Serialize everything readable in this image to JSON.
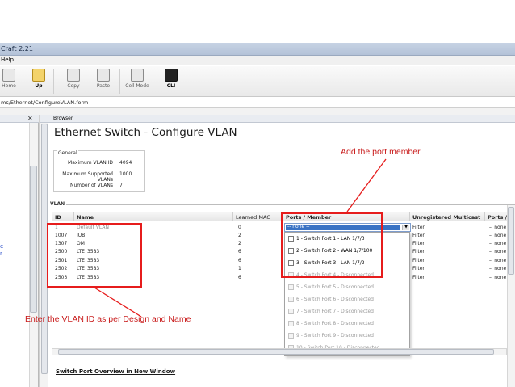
{
  "window": {
    "title": "Craft 2.21"
  },
  "menu": {
    "help": "Help"
  },
  "toolbar": {
    "home": "Home",
    "up": "Up",
    "copy": "Copy",
    "paste": "Paste",
    "cell_mode": "Cell Mode",
    "cli": "CLI"
  },
  "address": {
    "path": "ms/Ethernet/ConfigureVLAN.form"
  },
  "panes": {
    "close": "✕",
    "browser": "Browser",
    "left_links": [
      "e",
      "r"
    ]
  },
  "page": {
    "title": "Ethernet Switch - Configure VLAN"
  },
  "general": {
    "legend": "General",
    "rows": [
      {
        "label": "Maximum VLAN ID",
        "value": "4094"
      },
      {
        "label": "Maximum Supported VLANs",
        "value": "1000"
      },
      {
        "label": "Number of VLANs",
        "value": "7"
      }
    ]
  },
  "vlan": {
    "legend": "VLAN",
    "headers": {
      "id": "ID",
      "name": "Name",
      "learned": "Learned MAC",
      "ports": "Ports / Member",
      "unreg": "Unregistered Multicast",
      "ports2": "Ports / U"
    },
    "rows": [
      {
        "id": "1",
        "name": "Default VLAN",
        "learned": "0",
        "unreg": "Filter",
        "ports2": "-- none --"
      },
      {
        "id": "1007",
        "name": "IUB",
        "learned": "2",
        "unreg": "Filter",
        "ports2": "-- none --"
      },
      {
        "id": "1307",
        "name": "OM",
        "learned": "2",
        "unreg": "Filter",
        "ports2": "-- none --"
      },
      {
        "id": "2500",
        "name": "LTE_3583",
        "learned": "6",
        "unreg": "Filter",
        "ports2": "-- none --"
      },
      {
        "id": "2501",
        "name": "LTE_3583",
        "learned": "6",
        "unreg": "Filter",
        "ports2": "-- none --"
      },
      {
        "id": "2502",
        "name": "LTE_3583",
        "learned": "1",
        "unreg": "Filter",
        "ports2": "-- none --"
      },
      {
        "id": "2503",
        "name": "LTE_3583",
        "learned": "6",
        "unreg": "Filter",
        "ports2": "-- none --"
      }
    ],
    "port_select": {
      "value": "-- none --"
    },
    "port_options": [
      {
        "label": "1 - Switch Port 1 - LAN 1/7/3",
        "enabled": true
      },
      {
        "label": "2 - Switch Port 2 - WAN 1/7/100",
        "enabled": true
      },
      {
        "label": "3 - Switch Port 3 - LAN 1/7/2",
        "enabled": true
      },
      {
        "label": "4 - Switch Port 4 - Disconnected",
        "enabled": false
      },
      {
        "label": "5 - Switch Port 5 - Disconnected",
        "enabled": false
      },
      {
        "label": "6 - Switch Port 6 - Disconnected",
        "enabled": false
      },
      {
        "label": "7 - Switch Port 7 - Disconnected",
        "enabled": false
      },
      {
        "label": "8 - Switch Port 8 - Disconnected",
        "enabled": false
      },
      {
        "label": "9 - Switch Port 9 - Disconnected",
        "enabled": false
      },
      {
        "label": "10 - Switch Port 10 - Disconnected",
        "enabled": false
      }
    ]
  },
  "links": {
    "overview": "Switch Port Overview in New Window"
  },
  "annotations": {
    "port_member": "Add the port member",
    "vlan_id": "Enter the VLAN ID as per Design and Name",
    "color": "#e61c1c"
  }
}
